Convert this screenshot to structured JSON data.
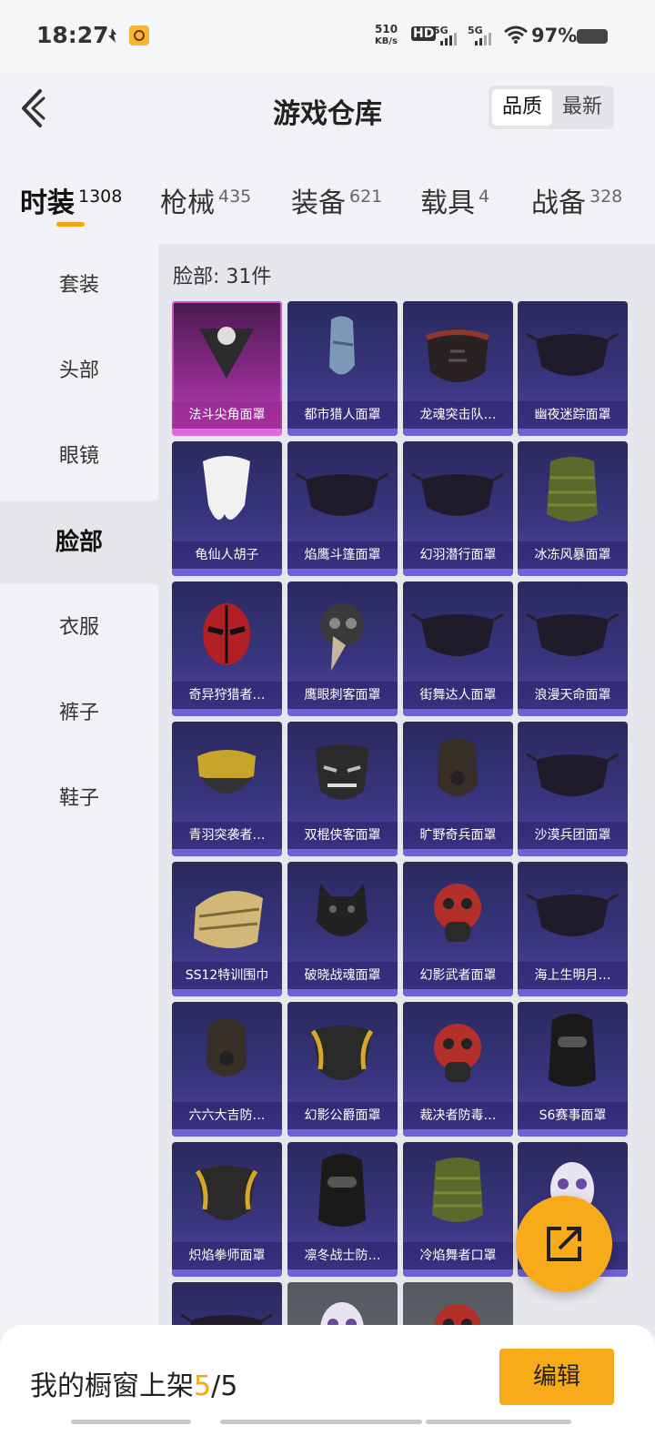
{
  "status_bar": {
    "time": "18:27",
    "net_rate_value": "510",
    "net_rate_unit": "KB/s",
    "hd": "HD",
    "signal_1": "5G",
    "signal_2": "5G",
    "battery": "97%"
  },
  "header": {
    "title": "游戏仓库",
    "sort_options": [
      "品质",
      "最新"
    ]
  },
  "tabs": [
    {
      "label": "时装",
      "count": "1308"
    },
    {
      "label": "枪械",
      "count": "435"
    },
    {
      "label": "装备",
      "count": "621"
    },
    {
      "label": "载具",
      "count": "4"
    },
    {
      "label": "战备",
      "count": "328"
    }
  ],
  "sidebar": [
    "套装",
    "头部",
    "眼镜",
    "脸部",
    "衣服",
    "裤子",
    "鞋子"
  ],
  "content": {
    "count_label": "脸部: 31件",
    "items": [
      {
        "name": "法斗尖角面罩",
        "icon": "bandana-mask-icon"
      },
      {
        "name": "都市猎人面罩",
        "icon": "scarf-mask-icon"
      },
      {
        "name": "龙魂突击队…",
        "icon": "tactical-mask-icon"
      },
      {
        "name": "幽夜迷踪面罩",
        "icon": "cloth-mask-icon"
      },
      {
        "name": "龟仙人胡子",
        "icon": "beard-icon"
      },
      {
        "name": "焰鹰斗篷面罩",
        "icon": "cloth-mask-icon"
      },
      {
        "name": "幻羽潜行面罩",
        "icon": "cloth-mask-icon"
      },
      {
        "name": "冰冻风暴面罩",
        "icon": "neck-gaiter-icon"
      },
      {
        "name": "奇异狩猎者…",
        "icon": "hero-mask-icon"
      },
      {
        "name": "鹰眼刺客面罩",
        "icon": "plague-mask-icon"
      },
      {
        "name": "街舞达人面罩",
        "icon": "cloth-mask-icon"
      },
      {
        "name": "浪漫天命面罩",
        "icon": "cloth-mask-icon"
      },
      {
        "name": "青羽突袭者…",
        "icon": "goggles-mask-icon"
      },
      {
        "name": "双棍侠客面罩",
        "icon": "demon-mask-icon"
      },
      {
        "name": "旷野奇兵面罩",
        "icon": "respirator-icon"
      },
      {
        "name": "沙漠兵团面罩",
        "icon": "cloth-mask-icon"
      },
      {
        "name": "SS12特训围巾",
        "icon": "shemagh-icon"
      },
      {
        "name": "破晓战魂面罩",
        "icon": "beast-mask-icon"
      },
      {
        "name": "幻影武者面罩",
        "icon": "gas-mask-icon"
      },
      {
        "name": "海上生明月…",
        "icon": "cloth-mask-icon"
      },
      {
        "name": "六六大吉防…",
        "icon": "respirator-icon"
      },
      {
        "name": "幻影公爵面罩",
        "icon": "gold-mask-icon"
      },
      {
        "name": "裁决者防毒…",
        "icon": "gas-mask-icon"
      },
      {
        "name": "S6赛事面罩",
        "icon": "balaclava-icon"
      },
      {
        "name": "炽焰拳师面罩",
        "icon": "gold-mask-icon"
      },
      {
        "name": "凛冬战士防…",
        "icon": "balaclava-icon"
      },
      {
        "name": "冷焰舞者口罩",
        "icon": "neck-gaiter-icon"
      },
      {
        "name": "",
        "icon": "skull-mask-icon"
      }
    ]
  },
  "fab_icon": "share-icon",
  "bottom_bar": {
    "label": "我的橱窗上架",
    "current": "5",
    "separator": "/",
    "total": "5",
    "edit": "编辑"
  },
  "colors": {
    "accent": "#f7ab1b",
    "card": "#3a3580",
    "card_highlight": "#c03cbc"
  }
}
